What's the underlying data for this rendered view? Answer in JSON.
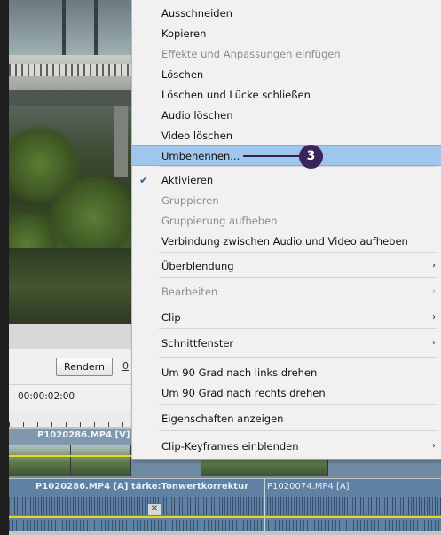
{
  "editor": {
    "render_button": "Rendern",
    "render_button_neighbor": "0",
    "timecode": "00:00:02:00",
    "video_clip_label": "P1020286.MP4 [V]",
    "audio_clip_label": "P1020286.MP4 [A] tärke:Tonwertkorrektur",
    "audio_clip_label_2": "P1020074.MP4 [A]",
    "transition_marker": "✕"
  },
  "context_menu": {
    "items": [
      {
        "label": "Ausschneiden",
        "enabled": true
      },
      {
        "label": "Kopieren",
        "enabled": true
      },
      {
        "label": "Effekte und Anpassungen einfügen",
        "enabled": false
      },
      {
        "label": "Löschen",
        "enabled": true
      },
      {
        "label": "Löschen und Lücke schließen",
        "enabled": true
      },
      {
        "label": "Audio löschen",
        "enabled": true
      },
      {
        "label": "Video löschen",
        "enabled": true
      },
      {
        "label": "Umbenennen...",
        "enabled": true,
        "highlighted": true
      },
      {
        "label": "Aktivieren",
        "enabled": true,
        "checked": true
      },
      {
        "label": "Gruppieren",
        "enabled": false
      },
      {
        "label": "Gruppierung aufheben",
        "enabled": false
      },
      {
        "label": "Verbindung zwischen Audio und Video aufheben",
        "enabled": true
      },
      {
        "label": "Überblendung",
        "enabled": true,
        "submenu": true
      },
      {
        "label": "Bearbeiten",
        "enabled": false,
        "submenu": true
      },
      {
        "label": "Clip",
        "enabled": true,
        "submenu": true
      },
      {
        "label": "Schnittfenster",
        "enabled": true,
        "submenu": true
      },
      {
        "label": "Um 90 Grad nach links drehen",
        "enabled": true
      },
      {
        "label": "Um 90 Grad nach rechts drehen",
        "enabled": true
      },
      {
        "label": "Eigenschaften anzeigen",
        "enabled": true
      },
      {
        "label": "Clip-Keyframes einblenden",
        "enabled": true,
        "submenu": true
      }
    ],
    "submenu_arrow": "›",
    "check_glyph": "✔"
  },
  "callout": {
    "number": "3"
  },
  "colors": {
    "highlight": "#9fc7ee",
    "callout": "#3a2558",
    "playhead": "#e01b1b",
    "video_track": "#6f8aa0",
    "audio_track": "#5f81a4"
  }
}
